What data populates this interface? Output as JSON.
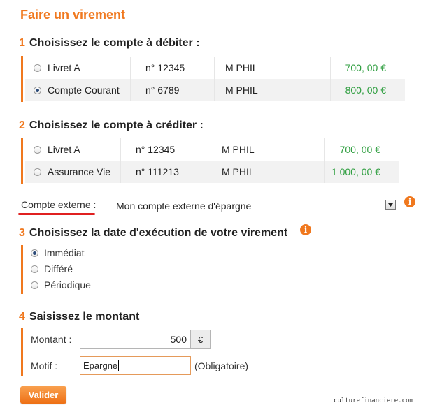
{
  "page": {
    "title": "Faire un virement"
  },
  "step1": {
    "number": "1",
    "title": "Choisissez le compte à débiter :",
    "accounts": [
      {
        "name": "Livret A",
        "number": "n° 12345",
        "holder": "M PHIL",
        "balance": "700, 00 €",
        "selected": false
      },
      {
        "name": "Compte Courant",
        "number": "n° 6789",
        "holder": "M PHIL",
        "balance": "800, 00 €",
        "selected": true
      }
    ]
  },
  "step2": {
    "number": "2",
    "title": "Choisissez le compte à créditer :",
    "accounts": [
      {
        "name": "Livret A",
        "number": "n° 12345",
        "holder": "M PHIL",
        "balance": "700, 00 €",
        "selected": false
      },
      {
        "name": "Assurance Vie",
        "number": "n° 111213",
        "holder": "M PHIL",
        "balance": "1 000, 00 €",
        "selected": false
      }
    ],
    "external": {
      "label": "Compte externe :",
      "selected_value": "Mon compte externe d'épargne"
    }
  },
  "step3": {
    "number": "3",
    "title": "Choisissez la date d'exécution de votre virement",
    "options": [
      {
        "label": "Immédiat",
        "selected": true
      },
      {
        "label": "Différé",
        "selected": false
      },
      {
        "label": "Périodique",
        "selected": false
      }
    ]
  },
  "step4": {
    "number": "4",
    "title": "Saisissez le montant",
    "amount_label": "Montant :",
    "amount_value": "500",
    "currency": "€",
    "reason_label": "Motif :",
    "reason_value": "Epargne",
    "reason_hint": "(Obligatoire)"
  },
  "submit_label": "Valider",
  "watermark": "culturefinanciere.com",
  "colors": {
    "accent": "#f0781e",
    "amount": "#2e9e3f",
    "underline": "#e02020"
  },
  "icons": {
    "info": "info-icon",
    "dropdown": "chevron-down-icon"
  }
}
